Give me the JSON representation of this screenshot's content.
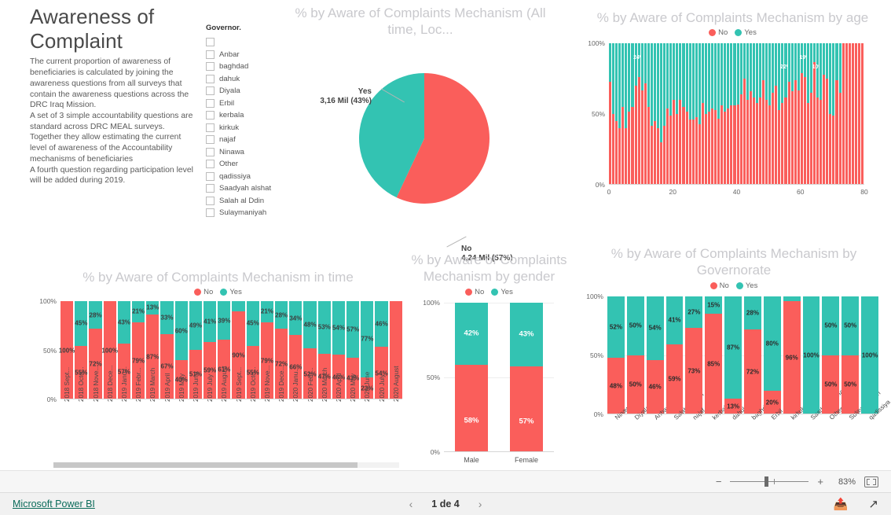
{
  "info": {
    "title": "Awareness of Complaint",
    "description": "The current proportion of awareness of beneficiaries is calculated by joining the awareness questions from all surveys that contain the awareness questions across the DRC Iraq Mission.\nA set of 3 simple accountability questions are standard across DRC MEAL surveys.\nTogether they allow estimating the current level of awareness of the Accountability mechanisms of beneficiaries\nA fourth question regarding participation level will be added during 2019."
  },
  "colors": {
    "no": "#FA5E5B",
    "yes": "#33C3B2",
    "title": "#c9c9cd",
    "link": "#0b6b5a"
  },
  "slicer": {
    "title": "Governor.",
    "items": [
      "",
      "Anbar",
      "baghdad",
      "dahuk",
      "Diyala",
      "Erbil",
      "kerbala",
      "kirkuk",
      "najaf",
      "Ninawa",
      "Other",
      "qadissiya",
      "Saadyah alshat",
      "Salah al Ddin",
      "Sulaymaniyah"
    ]
  },
  "legend": {
    "no": "No",
    "yes": "Yes"
  },
  "chart_data": [
    {
      "id": "pie",
      "type": "pie",
      "title": "% by Aware of Complaints Mechanism (All time, Loc...",
      "categories": [
        "No",
        "Yes"
      ],
      "values": [
        57,
        43
      ],
      "labels": [
        {
          "name": "Yes",
          "value": "3,16 Mil (43%)",
          "percent": 43,
          "color": "#33C3B2"
        },
        {
          "name": "No",
          "value": "4,24 Mil (57%)",
          "percent": 57,
          "color": "#FA5E5B"
        }
      ]
    },
    {
      "id": "age",
      "type": "bar",
      "title": "% by Aware of Complaints Mechanism by age",
      "xlabel": "",
      "ylabel": "",
      "ylim": [
        0,
        100
      ],
      "yticks": [
        "0%",
        "50%",
        "100%"
      ],
      "xticks": [
        "0",
        "20",
        "40",
        "60",
        "80"
      ],
      "legend": [
        "No",
        "Yes"
      ],
      "x": [
        1,
        2,
        3,
        4,
        5,
        6,
        7,
        8,
        9,
        10,
        11,
        12,
        13,
        14,
        15,
        16,
        17,
        18,
        19,
        20,
        21,
        22,
        23,
        24,
        25,
        26,
        27,
        28,
        29,
        30,
        31,
        32,
        33,
        34,
        35,
        36,
        37,
        38,
        39,
        40,
        41,
        42,
        43,
        44,
        45,
        46,
        47,
        48,
        49,
        50,
        51,
        52,
        53,
        54,
        55,
        56,
        57,
        58,
        59,
        60,
        61,
        62,
        63,
        64,
        65,
        66,
        67,
        68,
        69,
        70,
        71,
        72,
        73,
        74,
        75,
        76,
        77,
        78,
        79,
        80
      ],
      "series": [
        {
          "name": "No",
          "values": [
            73,
            50,
            45,
            40,
            55,
            40,
            52,
            55,
            70,
            76,
            67,
            72,
            55,
            42,
            45,
            40,
            30,
            42,
            54,
            49,
            60,
            50,
            60,
            55,
            52,
            46,
            46,
            48,
            43,
            58,
            50,
            52,
            54,
            53,
            47,
            56,
            52,
            54,
            56,
            56,
            57,
            64,
            75,
            60,
            66,
            62,
            58,
            62,
            74,
            60,
            56,
            65,
            70,
            53,
            58,
            62,
            73,
            66,
            74,
            67,
            79,
            76,
            58,
            65,
            87,
            62,
            60,
            78,
            75,
            50,
            49,
            74,
            65,
            100,
            100,
            100,
            100,
            100,
            100,
            100
          ]
        },
        {
          "name": "Yes",
          "values": [
            27,
            50,
            55,
            60,
            45,
            60,
            48,
            45,
            30,
            24,
            33,
            28,
            45,
            58,
            55,
            60,
            70,
            58,
            46,
            51,
            40,
            50,
            40,
            45,
            48,
            54,
            54,
            52,
            57,
            42,
            50,
            48,
            46,
            47,
            53,
            44,
            48,
            46,
            44,
            44,
            43,
            36,
            25,
            40,
            34,
            38,
            42,
            38,
            26,
            40,
            44,
            35,
            30,
            47,
            42,
            38,
            27,
            34,
            26,
            33,
            21,
            24,
            42,
            35,
            13,
            38,
            40,
            22,
            25,
            50,
            51,
            26,
            35,
            0,
            0,
            0,
            0,
            0,
            0,
            0
          ]
        }
      ],
      "data_labels": [
        {
          "x": 10,
          "text": "24%"
        },
        {
          "x": 56,
          "text": "22%"
        },
        {
          "x": 62,
          "text": "19%"
        },
        {
          "x": 66,
          "text": "10%"
        }
      ]
    },
    {
      "id": "time",
      "type": "bar",
      "title": "% by Aware of Complaints Mechanism in time",
      "xlabel": "",
      "ylabel": "",
      "ylim": [
        0,
        100
      ],
      "yticks": [
        "0%",
        "50%",
        "100%"
      ],
      "legend": [
        "No",
        "Yes"
      ],
      "categories": [
        "2018 Sept...",
        "2018 Octo...",
        "2018 Nove...",
        "2018 Dece...",
        "2019 Janu...",
        "2019 Febr...",
        "2019 March",
        "2019 April",
        "2019 May",
        "2019 June",
        "2019 July",
        "2019 August",
        "2019 Sept...",
        "2019 Octo...",
        "2019 Nove...",
        "2019 Dece...",
        "2020 Janu...",
        "2020 Febr...",
        "2020 March",
        "2020 April",
        "2020 May",
        "2020 June",
        "2020 July",
        "2020 August"
      ],
      "series": [
        {
          "name": "No",
          "values": [
            100,
            55,
            72,
            100,
            57,
            79,
            87,
            67,
            40,
            51,
            59,
            61,
            90,
            55,
            79,
            72,
            66,
            52,
            47,
            46,
            43,
            23,
            54,
            100
          ]
        },
        {
          "name": "Yes",
          "values": [
            0,
            45,
            28,
            0,
            43,
            21,
            13,
            33,
            60,
            49,
            41,
            39,
            10,
            45,
            21,
            28,
            34,
            48,
            53,
            54,
            57,
            77,
            46,
            0
          ]
        }
      ],
      "no_labels": [
        "100%",
        "55%",
        "72%",
        "100%",
        "57%",
        "79%",
        "87%",
        "67%",
        "40%",
        "51%",
        "59%",
        "61%",
        "90%",
        "55%",
        "79%",
        "72%",
        "66%",
        "52%",
        "47%",
        "46%",
        "43%",
        "23%",
        "54%",
        ""
      ],
      "yes_labels": [
        "",
        "45%",
        "28%",
        "",
        "43%",
        "21%",
        "13%",
        "33%",
        "60%",
        "49%",
        "41%",
        "39%",
        "",
        "45%",
        "21%",
        "28%",
        "34%",
        "48%",
        "53%",
        "54%",
        "57%",
        "77%",
        "46%",
        ""
      ]
    },
    {
      "id": "gender",
      "type": "bar",
      "title": "% by Aware of Complaints Mechanism by gender",
      "xlabel": "",
      "ylabel": "",
      "ylim": [
        0,
        100
      ],
      "yticks": [
        "0%",
        "50%",
        "100%"
      ],
      "legend": [
        "No",
        "Yes"
      ],
      "categories": [
        "Male",
        "Female"
      ],
      "series": [
        {
          "name": "No",
          "values": [
            58,
            57
          ]
        },
        {
          "name": "Yes",
          "values": [
            42,
            43
          ]
        }
      ],
      "no_labels": [
        "58%",
        "57%"
      ],
      "yes_labels": [
        "42%",
        "43%"
      ]
    },
    {
      "id": "governorate",
      "type": "bar",
      "title": "% by Aware of Complaints Mechanism by Governorate",
      "xlabel": "",
      "ylabel": "",
      "ylim": [
        0,
        100
      ],
      "yticks": [
        "0%",
        "50%",
        "100%"
      ],
      "legend": [
        "No",
        "Yes"
      ],
      "categories": [
        "Ninawa",
        "Diyala",
        "Anbar",
        "Salah al Ddin",
        "najaf",
        "kerbala",
        "dahuk",
        "baghdad",
        "Erbil",
        "kirkuk",
        "Saadyah alshat",
        "Other",
        "Sulaymaniyah",
        "qadissiya"
      ],
      "series": [
        {
          "name": "No",
          "values": [
            48,
            50,
            46,
            59,
            73,
            85,
            13,
            72,
            20,
            96,
            0,
            50,
            50,
            0
          ]
        },
        {
          "name": "Yes",
          "values": [
            52,
            50,
            54,
            41,
            27,
            15,
            87,
            28,
            80,
            4,
            100,
            50,
            50,
            100
          ]
        }
      ],
      "no_labels": [
        "48%",
        "50%",
        "46%",
        "59%",
        "73%",
        "85%",
        "13%",
        "72%",
        "20%",
        "96%",
        "",
        "50%",
        "50%",
        ""
      ],
      "yes_labels": [
        "52%",
        "50%",
        "54%",
        "41%",
        "27%",
        "15%",
        "87%",
        "28%",
        "80%",
        "",
        "100%",
        "50%",
        "50%",
        "100%"
      ]
    }
  ],
  "zoombar": {
    "minus": "−",
    "plus": "+",
    "percent": "83%"
  },
  "footer": {
    "brand": "Microsoft Power BI",
    "prev": "‹",
    "page": "1 de 4",
    "next": "›"
  }
}
